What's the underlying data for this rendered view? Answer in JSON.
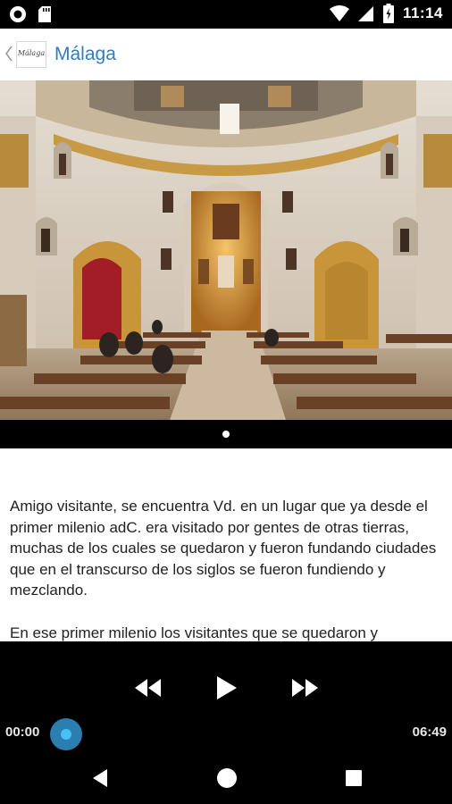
{
  "status_bar": {
    "time": "11:14",
    "left_icons": [
      "record-icon",
      "sd-card-icon"
    ],
    "right_icons": [
      "wifi-icon",
      "cell-signal-icon",
      "battery-icon"
    ]
  },
  "app_bar": {
    "logo_text": "Málaga",
    "title": "Málaga"
  },
  "gallery": {
    "image_subject": "church-interior-photo",
    "page_count": 1,
    "current_page": 1
  },
  "content": {
    "paragraphs": [
      "Amigo visitante, se encuentra Vd. en un lugar que ya desde el primer milenio adC. era visitado por gentes de otras tierras, muchas de los cuales se quedaron y fueron fundando ciudades que en el transcurso de los siglos se fueron fundiendo y mezclando.",
      "En ese primer milenio los visitantes que se quedaron y"
    ]
  },
  "player": {
    "current_time": "00:00",
    "duration": "06:49",
    "progress": 0,
    "controls": [
      "rewind-icon",
      "play-icon",
      "fast-forward-icon"
    ],
    "accent_color": "#49c0f2"
  },
  "nav_bar": {
    "buttons": [
      "back-icon",
      "home-icon",
      "recents-icon"
    ]
  }
}
